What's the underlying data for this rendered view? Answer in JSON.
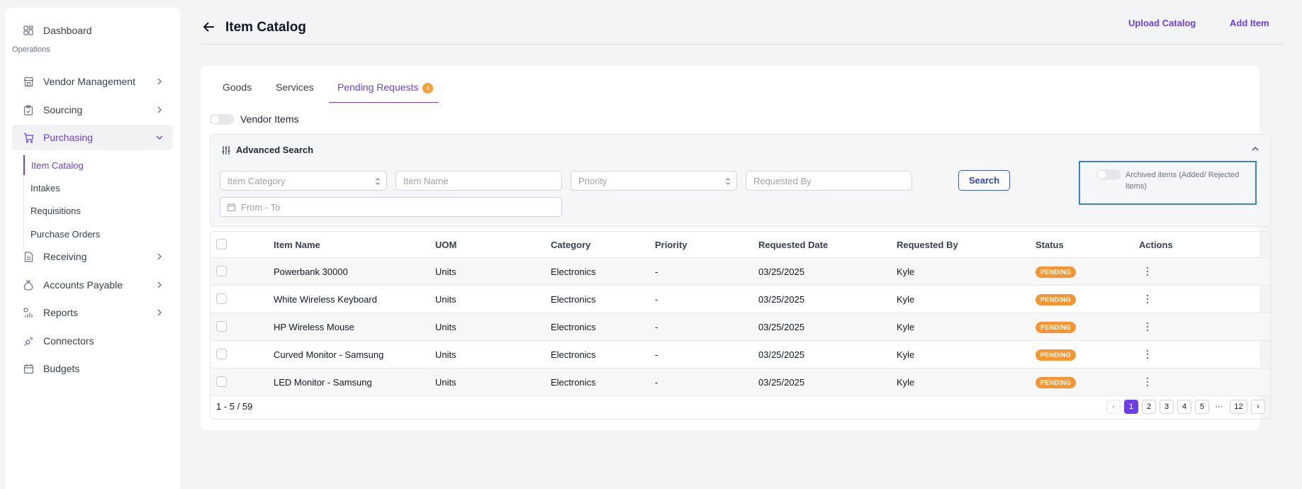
{
  "sidebar": {
    "dashboard": "Dashboard",
    "section_label": "Operations",
    "items": {
      "vendor_management": "Vendor Management",
      "sourcing": "Sourcing",
      "purchasing": "Purchasing",
      "receiving": "Receiving",
      "accounts_payable": "Accounts Payable",
      "reports": "Reports",
      "connectors": "Connectors",
      "budgets": "Budgets"
    },
    "purchasing_sub": {
      "item_catalog": "Item Catalog",
      "intakes": "Intakes",
      "requisitions": "Requisitions",
      "purchase_orders": "Purchase Orders"
    }
  },
  "header": {
    "title": "Item Catalog",
    "upload_catalog": "Upload Catalog",
    "add_item": "Add Item"
  },
  "tabs": {
    "goods": "Goods",
    "services": "Services",
    "pending_requests": "Pending Requests",
    "pending_badge": "5"
  },
  "vendor_items_label": "Vendor Items",
  "advanced_search": {
    "title": "Advanced Search",
    "item_category_placeholder": "Item Category",
    "item_name_placeholder": "Item Name",
    "priority_placeholder": "Priority",
    "requested_by_placeholder": "Requested By",
    "date_placeholder": "From - To",
    "search_button": "Search",
    "archived_label": "Archived items (Added/ Rejected items)"
  },
  "table": {
    "headers": {
      "item_name": "Item Name",
      "uom": "UOM",
      "category": "Category",
      "priority": "Priority",
      "requested_date": "Requested Date",
      "requested_by": "Requested By",
      "status": "Status",
      "actions": "Actions"
    },
    "rows": [
      {
        "item_name": "Powerbank 30000",
        "uom": "Units",
        "category": "Electronics",
        "priority": "-",
        "requested_date": "03/25/2025",
        "requested_by": "Kyle",
        "status": "PENDING"
      },
      {
        "item_name": "White Wireless Keyboard",
        "uom": "Units",
        "category": "Electronics",
        "priority": "-",
        "requested_date": "03/25/2025",
        "requested_by": "Kyle",
        "status": "PENDING"
      },
      {
        "item_name": "HP Wireless Mouse",
        "uom": "Units",
        "category": "Electronics",
        "priority": "-",
        "requested_date": "03/25/2025",
        "requested_by": "Kyle",
        "status": "PENDING"
      },
      {
        "item_name": "Curved Monitor - Samsung",
        "uom": "Units",
        "category": "Electronics",
        "priority": "-",
        "requested_date": "03/25/2025",
        "requested_by": "Kyle",
        "status": "PENDING"
      },
      {
        "item_name": "LED Monitor - Samsung",
        "uom": "Units",
        "category": "Electronics",
        "priority": "-",
        "requested_date": "03/25/2025",
        "requested_by": "Kyle",
        "status": "PENDING"
      }
    ],
    "count_text": "1 - 5 / 59"
  },
  "pagination": {
    "prev": "‹",
    "pages": [
      "1",
      "2",
      "3",
      "4",
      "5"
    ],
    "ellipsis": "···",
    "last": "12",
    "next": "›",
    "current": "1"
  },
  "colors": {
    "accent": "#6d3ee6",
    "status_pending": "#f59632",
    "search_border": "#3f5bd3"
  }
}
